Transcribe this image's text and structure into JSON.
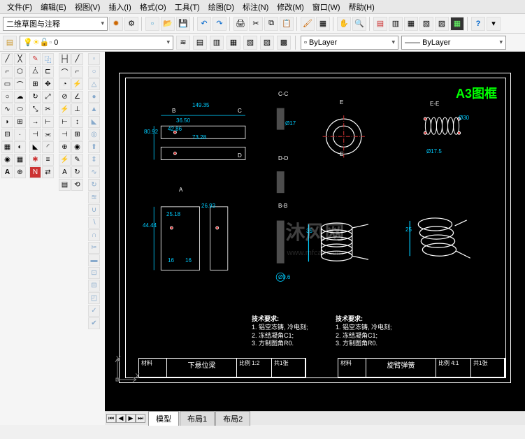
{
  "menu": {
    "file": "文件(F)",
    "edit": "编辑(E)",
    "view": "视图(V)",
    "insert": "插入(I)",
    "format": "格式(O)",
    "tools": "工具(T)",
    "draw": "绘图(D)",
    "dimension": "标注(N)",
    "modify": "修改(M)",
    "window": "窗口(W)",
    "help": "帮助(H)"
  },
  "workspace_combo": "二维草图与注释",
  "layer_combo": "0",
  "bylayer1": "ByLayer",
  "bylayer2": "ByLayer",
  "tabs": {
    "model": "模型",
    "layout1": "布局1",
    "layout2": "布局2"
  },
  "drawing": {
    "frame_title": "A3图框",
    "watermark": "沐风网",
    "watermark_url": "www.mfcad.com",
    "ucs_x": "X",
    "ucs_y": "Y",
    "left": {
      "tech_req_title": "技术要求:",
      "tech_req_1": "1. 铝空冻铸, 冷电刻;",
      "tech_req_2": "2. 冻结凝角C1;",
      "tech_req_3": "3. 方制图角R0.",
      "title_name": "下悬位梁",
      "sections": {
        "cc": "C-C",
        "bb": "B-B",
        "dd": "D-D"
      },
      "dims": {
        "d1": "149.35",
        "d2": "36.50",
        "d3": "42.86",
        "d4": "73.28",
        "d5": "80.92",
        "d6": "26.93",
        "d7": "25.18",
        "d8": "16",
        "d9": "16",
        "d10": "44.44",
        "d11": "Ø17",
        "d12": "Ø9.6"
      },
      "marks": {
        "a": "A",
        "b": "B",
        "c": "C",
        "d": "D",
        "e": "E"
      }
    },
    "right": {
      "tech_req_title": "技术要求:",
      "tech_req_1": "1. 铝空冻铸, 冷电刻;",
      "tech_req_2": "2. 冻结凝角C1;",
      "tech_req_3": "3. 方制图角R0.",
      "title_name": "旋臂弹簧",
      "sections": {
        "ee": "E-E"
      },
      "dims": {
        "d1": "Ø30",
        "d2": "Ø17.5",
        "d3": "35",
        "d4": "25"
      },
      "marks": {
        "e": "E"
      }
    },
    "title_block": {
      "proportion": "比例 1:2",
      "proportion2": "比例 4:1",
      "sheet": "共1张",
      "material": "材料"
    }
  }
}
